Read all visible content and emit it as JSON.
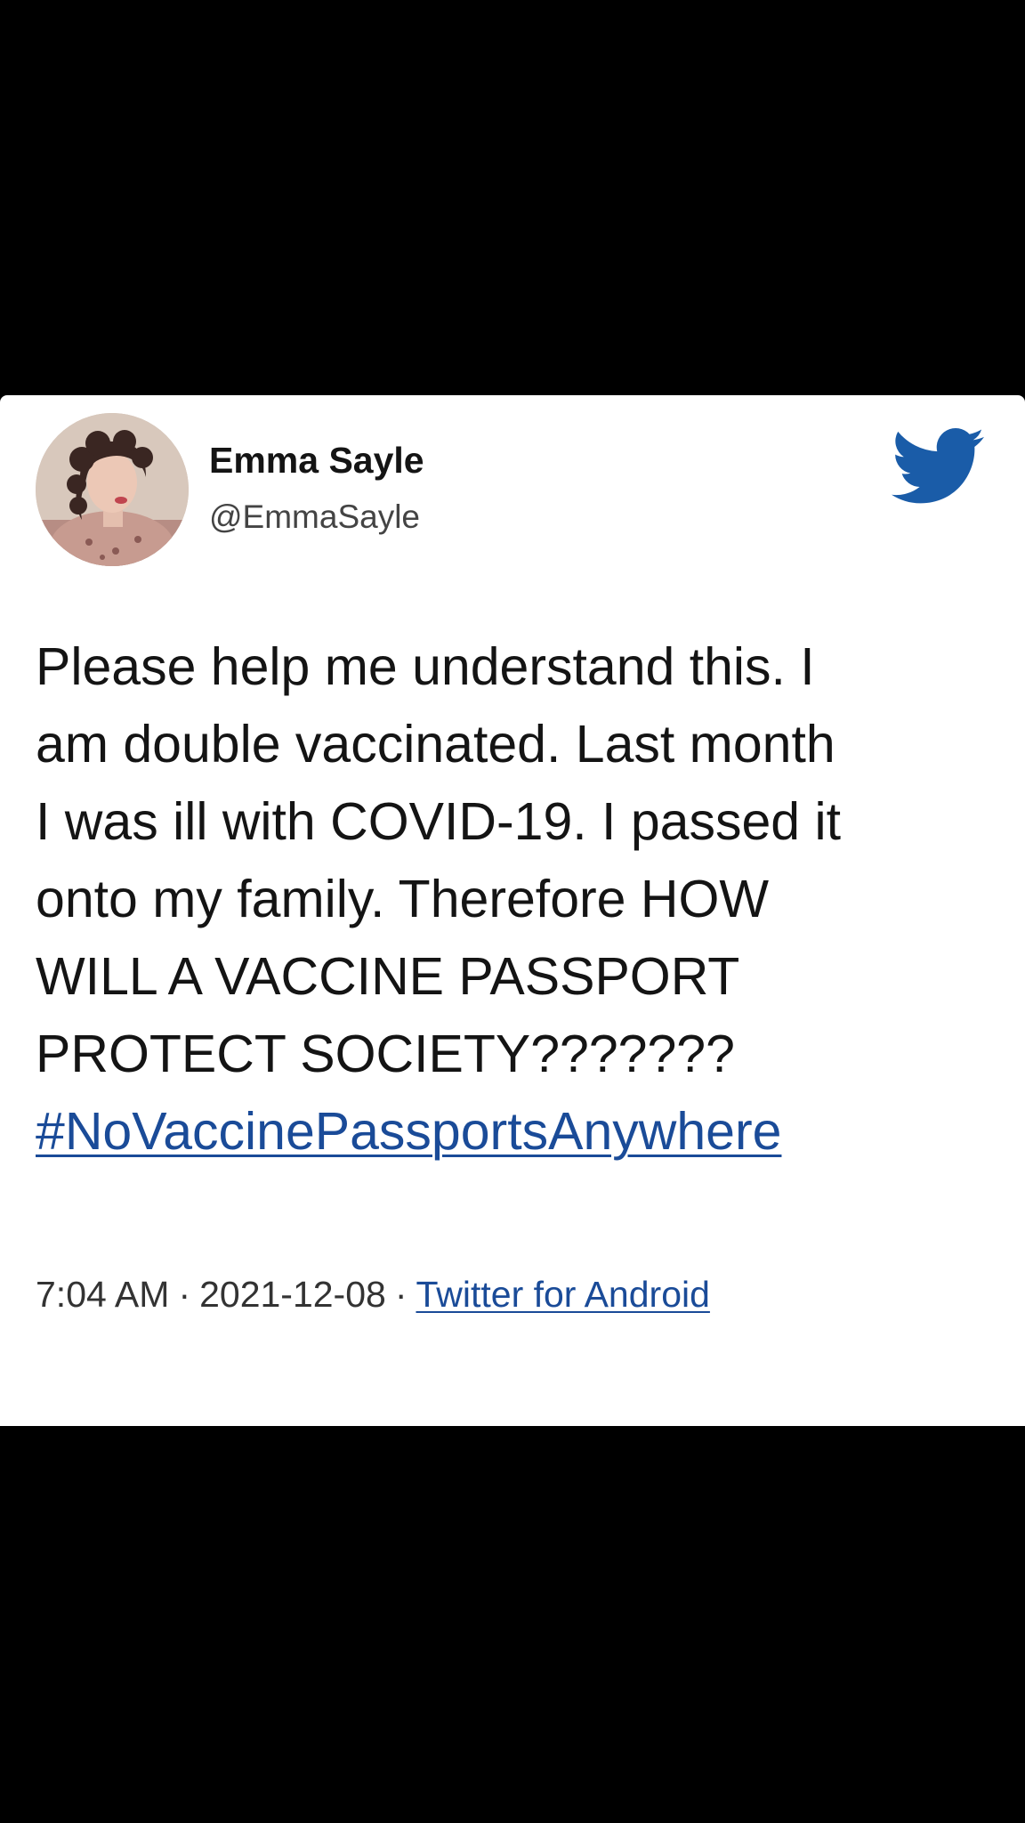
{
  "tweet": {
    "author": {
      "display_name": "Emma Sayle",
      "handle": "@EmmaSayle"
    },
    "brand_icon": "twitter-bird-icon",
    "body_lines": [
      "Please help me understand this. I",
      "am double vaccinated. Last month",
      "I was ill with COVID-19. I passed it",
      "onto my family. Therefore HOW",
      "WILL A VACCINE PASSPORT",
      "PROTECT SOCIETY???????"
    ],
    "hashtag": "#NoVaccinePassportsAnywhere",
    "meta": {
      "time": "7:04 AM",
      "separator": "·",
      "date": "2021-12-08",
      "source": "Twitter for Android"
    }
  },
  "colors": {
    "background": "#000000",
    "card": "#ffffff",
    "text": "#141414",
    "link": "#1a4b98",
    "brand": "#1a5ca8"
  }
}
